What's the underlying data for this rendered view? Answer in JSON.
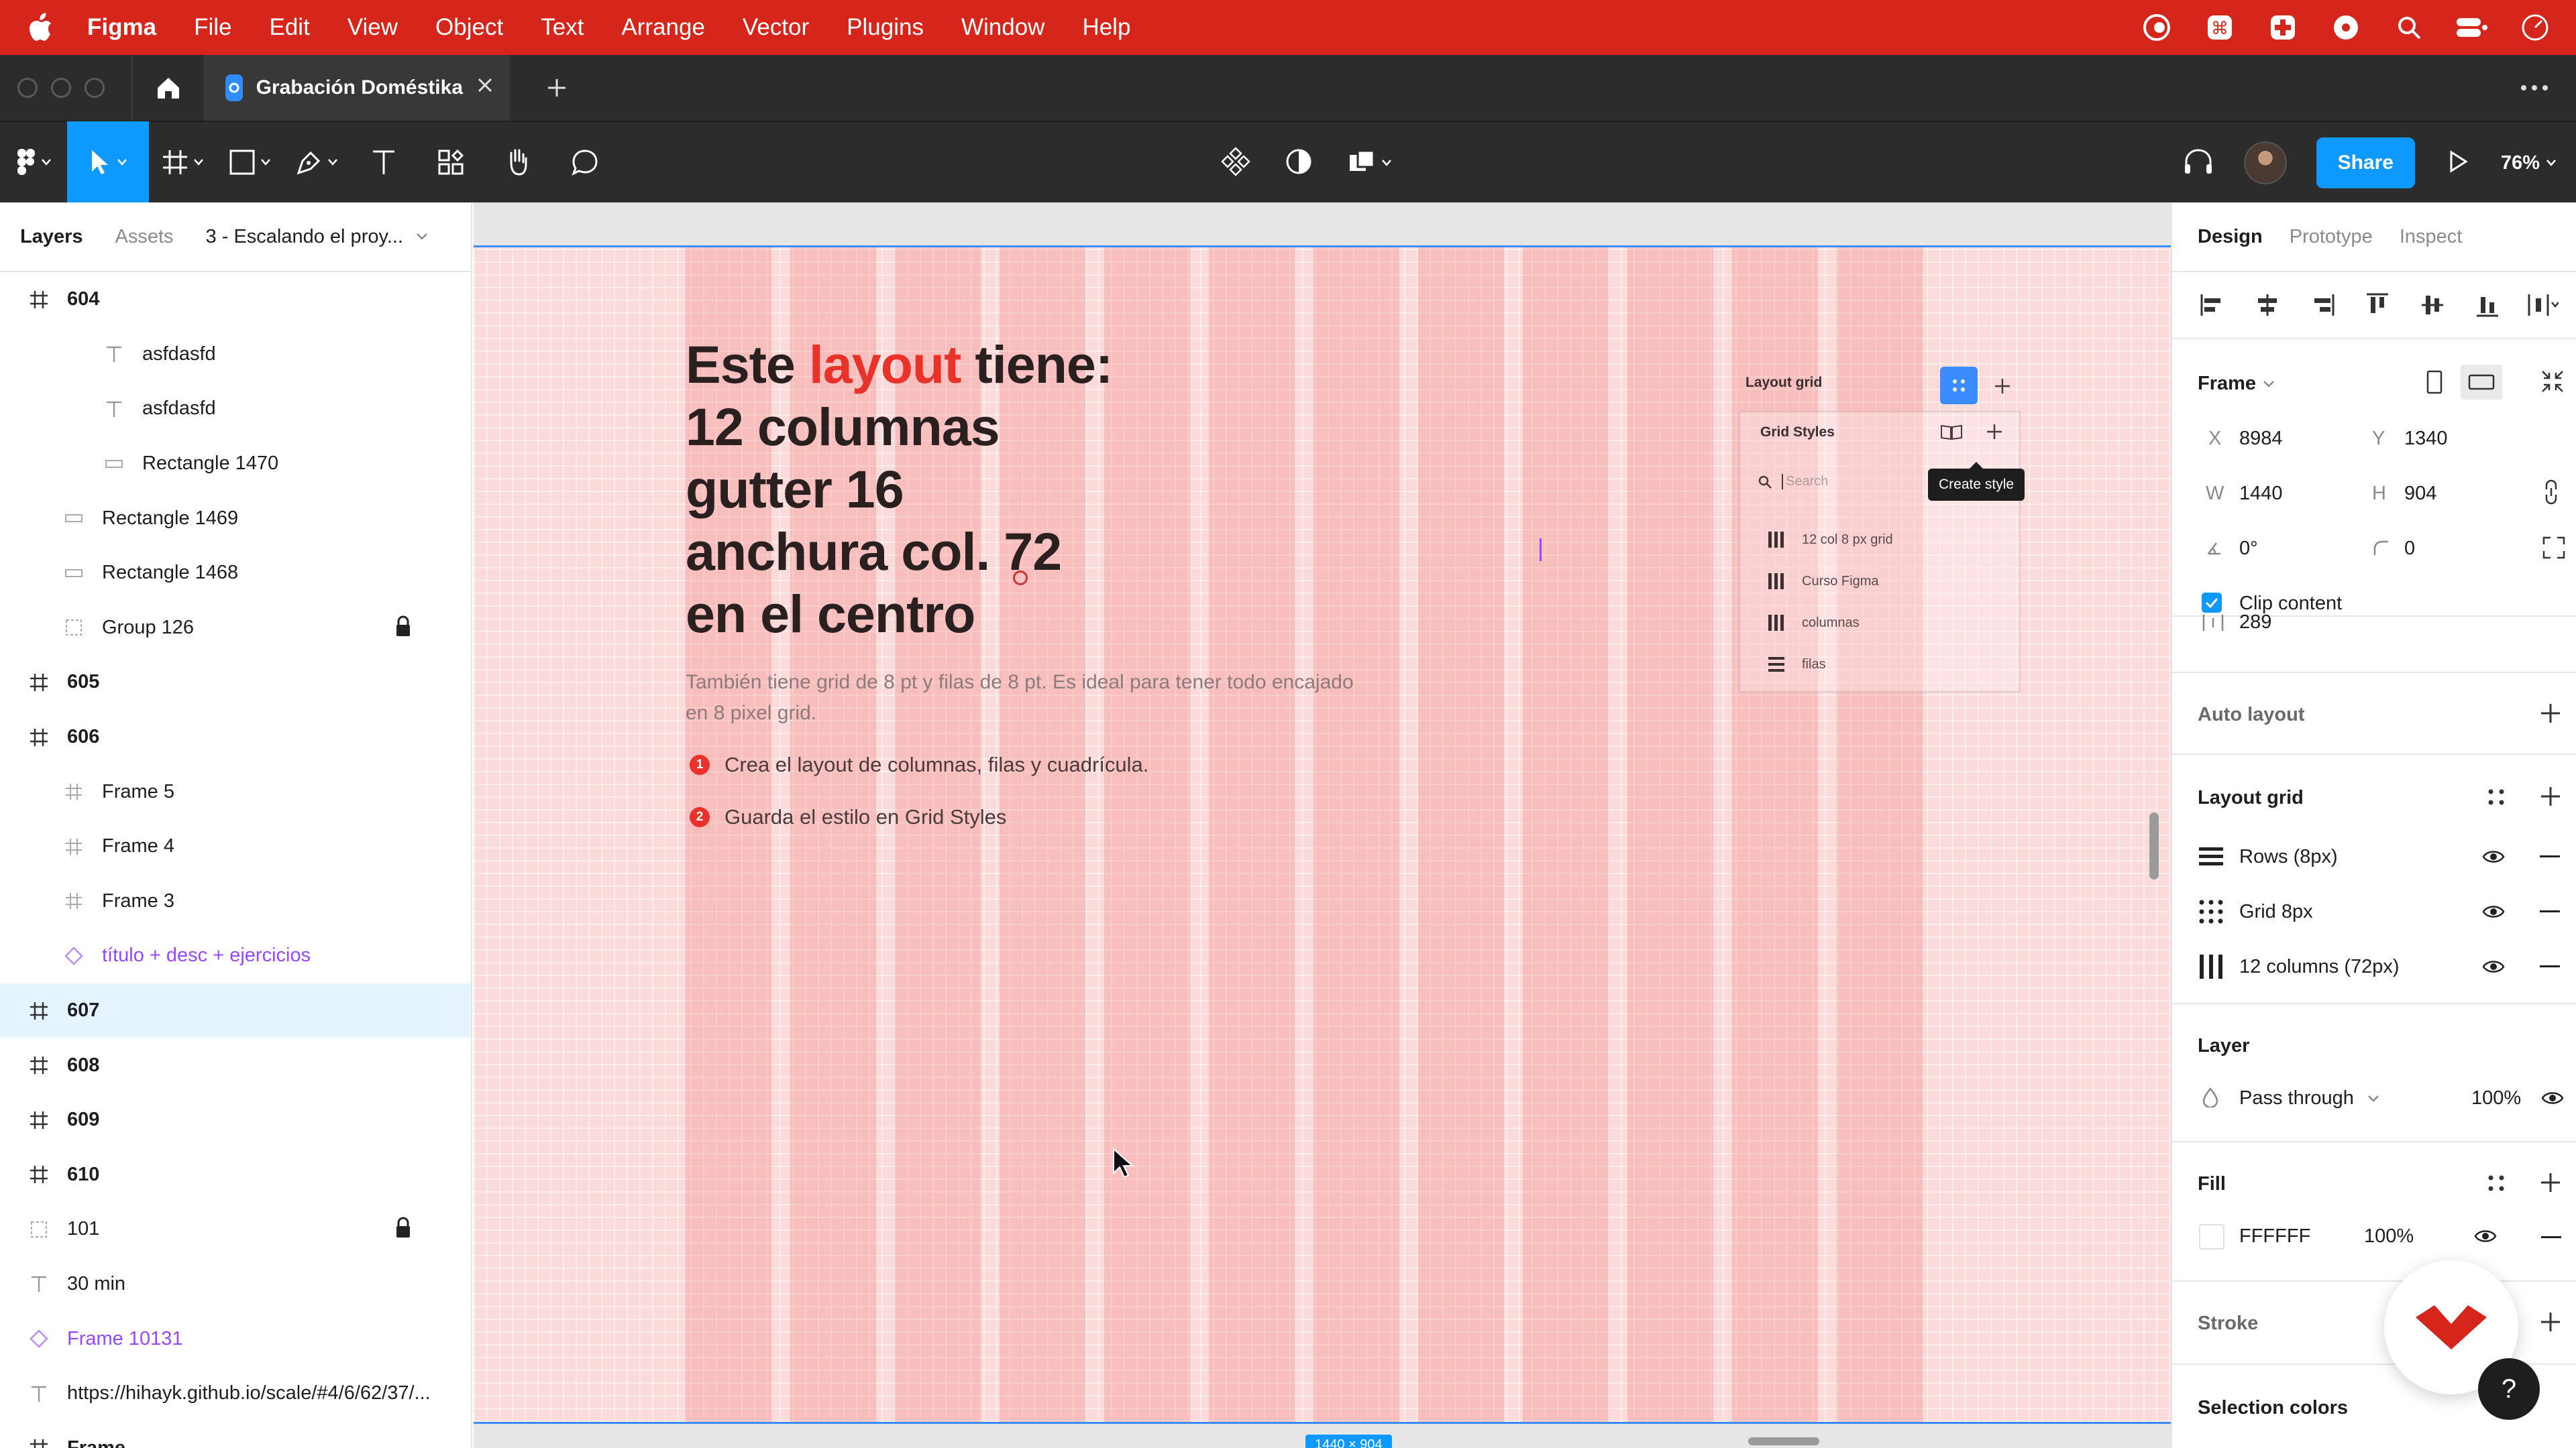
{
  "menubar": {
    "app": "Figma",
    "items": [
      "File",
      "Edit",
      "View",
      "Object",
      "Text",
      "Arrange",
      "Vector",
      "Plugins",
      "Window",
      "Help"
    ]
  },
  "tabbar": {
    "tab_title": "Grabación Doméstika"
  },
  "toolbar": {
    "share_label": "Share",
    "zoom": "76%"
  },
  "left_panel": {
    "tabs": [
      "Layers",
      "Assets"
    ],
    "page_selector": "3 - Escalando el proy...",
    "layers": [
      {
        "name": "604",
        "type": "frame",
        "indent": 0,
        "bold": true
      },
      {
        "name": "asfdasfd",
        "type": "text",
        "indent": 2
      },
      {
        "name": "asfdasfd",
        "type": "text",
        "indent": 2
      },
      {
        "name": "Rectangle 1470",
        "type": "rect",
        "indent": 2
      },
      {
        "name": "Rectangle 1469",
        "type": "rect",
        "indent": 1
      },
      {
        "name": "Rectangle 1468",
        "type": "rect",
        "indent": 1
      },
      {
        "name": "Group 126",
        "type": "group",
        "indent": 1,
        "locked": true
      },
      {
        "name": "605",
        "type": "frame",
        "indent": 0,
        "bold": true
      },
      {
        "name": "606",
        "type": "frame",
        "indent": 0,
        "bold": true
      },
      {
        "name": "Frame 5",
        "type": "frame-sub",
        "indent": 1
      },
      {
        "name": "Frame 4",
        "type": "frame-sub",
        "indent": 1
      },
      {
        "name": "Frame 3",
        "type": "frame-sub",
        "indent": 1
      },
      {
        "name": "título + desc + ejercicios",
        "type": "component",
        "indent": 1
      },
      {
        "name": "607",
        "type": "frame",
        "indent": 0,
        "bold": true,
        "selected": true
      },
      {
        "name": "608",
        "type": "frame",
        "indent": 0,
        "bold": true
      },
      {
        "name": "609",
        "type": "frame",
        "indent": 0,
        "bold": true
      },
      {
        "name": "610",
        "type": "frame",
        "indent": 0,
        "bold": true
      },
      {
        "name": "101",
        "type": "group",
        "indent": 0,
        "locked": true
      },
      {
        "name": "30 min",
        "type": "text",
        "indent": 0
      },
      {
        "name": "Frame 10131",
        "type": "component",
        "indent": 0
      },
      {
        "name": "https://hihayk.github.io/scale/#4/6/62/37/...",
        "type": "text",
        "indent": 0
      },
      {
        "name": "Frame",
        "type": "frame",
        "indent": 0,
        "bold": true
      }
    ]
  },
  "canvas": {
    "hero_pre": "Este ",
    "hero_accent": "layout",
    "hero_post": " tiene:",
    "hero_lines": [
      "12 columnas",
      "gutter 16",
      "anchura col. 72",
      "en el centro"
    ],
    "description": "También tiene grid de 8 pt y filas de 8 pt. Es ideal para tener todo encajado en 8 pixel grid.",
    "steps": [
      {
        "num": "1",
        "text": "Crea el layout de columnas, filas y cuadrícula."
      },
      {
        "num": "2",
        "text": "Guarda el estilo en Grid Styles"
      }
    ],
    "popover": {
      "title": "Layout grid",
      "grid_styles": "Grid Styles",
      "search_placeholder": "Search",
      "tooltip": "Create style",
      "styles": [
        "12 col 8 px grid",
        "Curso Figma",
        "columnas",
        "filas"
      ]
    },
    "size_badge": "1440 × 904",
    "grid_columns": 12
  },
  "right_panel": {
    "tabs": [
      "Design",
      "Prototype",
      "Inspect"
    ],
    "frame": {
      "title": "Frame",
      "x_label": "X",
      "x": "8984",
      "y_label": "Y",
      "y": "1340",
      "w_label": "W",
      "w": "1440",
      "h_label": "H",
      "h": "904",
      "rotation": "0°",
      "radius": "0",
      "clip_content": "Clip content",
      "spacing": "289"
    },
    "auto_layout": "Auto layout",
    "layout_grid": {
      "title": "Layout grid",
      "items": [
        "Rows (8px)",
        "Grid 8px",
        "12 columns (72px)"
      ]
    },
    "layer": {
      "title": "Layer",
      "blend": "Pass through",
      "opacity": "100%"
    },
    "fill": {
      "title": "Fill",
      "hex": "FFFFFF",
      "opacity": "100%"
    },
    "stroke": "Stroke",
    "selection_colors": "Selection colors"
  },
  "colors": {
    "menubar": "#d6261b",
    "accent": "#0d99ff",
    "brand_red": "#e8322a"
  }
}
